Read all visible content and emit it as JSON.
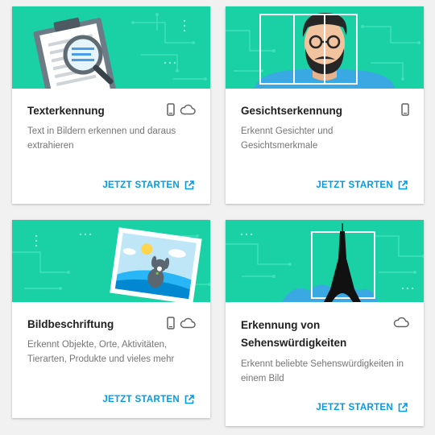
{
  "cards": [
    {
      "title": "Texterkennung",
      "description": "Text in Bildern erkennen und daraus extrahieren",
      "cta": "JETZT STARTEN",
      "icons": [
        "phone-icon",
        "cloud-icon"
      ],
      "illustration": "clipboard-magnifier"
    },
    {
      "title": "Gesichtserkennung",
      "description": "Erkennt Gesichter und Gesichtsmerkmale",
      "cta": "JETZT STARTEN",
      "icons": [
        "phone-icon"
      ],
      "illustration": "face-with-glasses"
    },
    {
      "title": "Bildbeschriftung",
      "description": "Erkennt Objekte, Orte, Aktivitäten, Tierarten, Produkte und vieles mehr",
      "cta": "JETZT STARTEN",
      "icons": [
        "phone-icon",
        "cloud-icon"
      ],
      "illustration": "photo-with-dog"
    },
    {
      "title": "Erkennung von Sehenswürdigkeiten",
      "description": "Erkennt beliebte Sehenswürdigkeiten in einem Bild",
      "cta": "JETZT STARTEN",
      "icons": [
        "cloud-icon"
      ],
      "illustration": "eiffel-tower"
    }
  ],
  "colors": {
    "hero": "#1ad1a5",
    "accent": "#039be5",
    "title": "#212121",
    "text": "#757575",
    "icon": "#616161"
  }
}
